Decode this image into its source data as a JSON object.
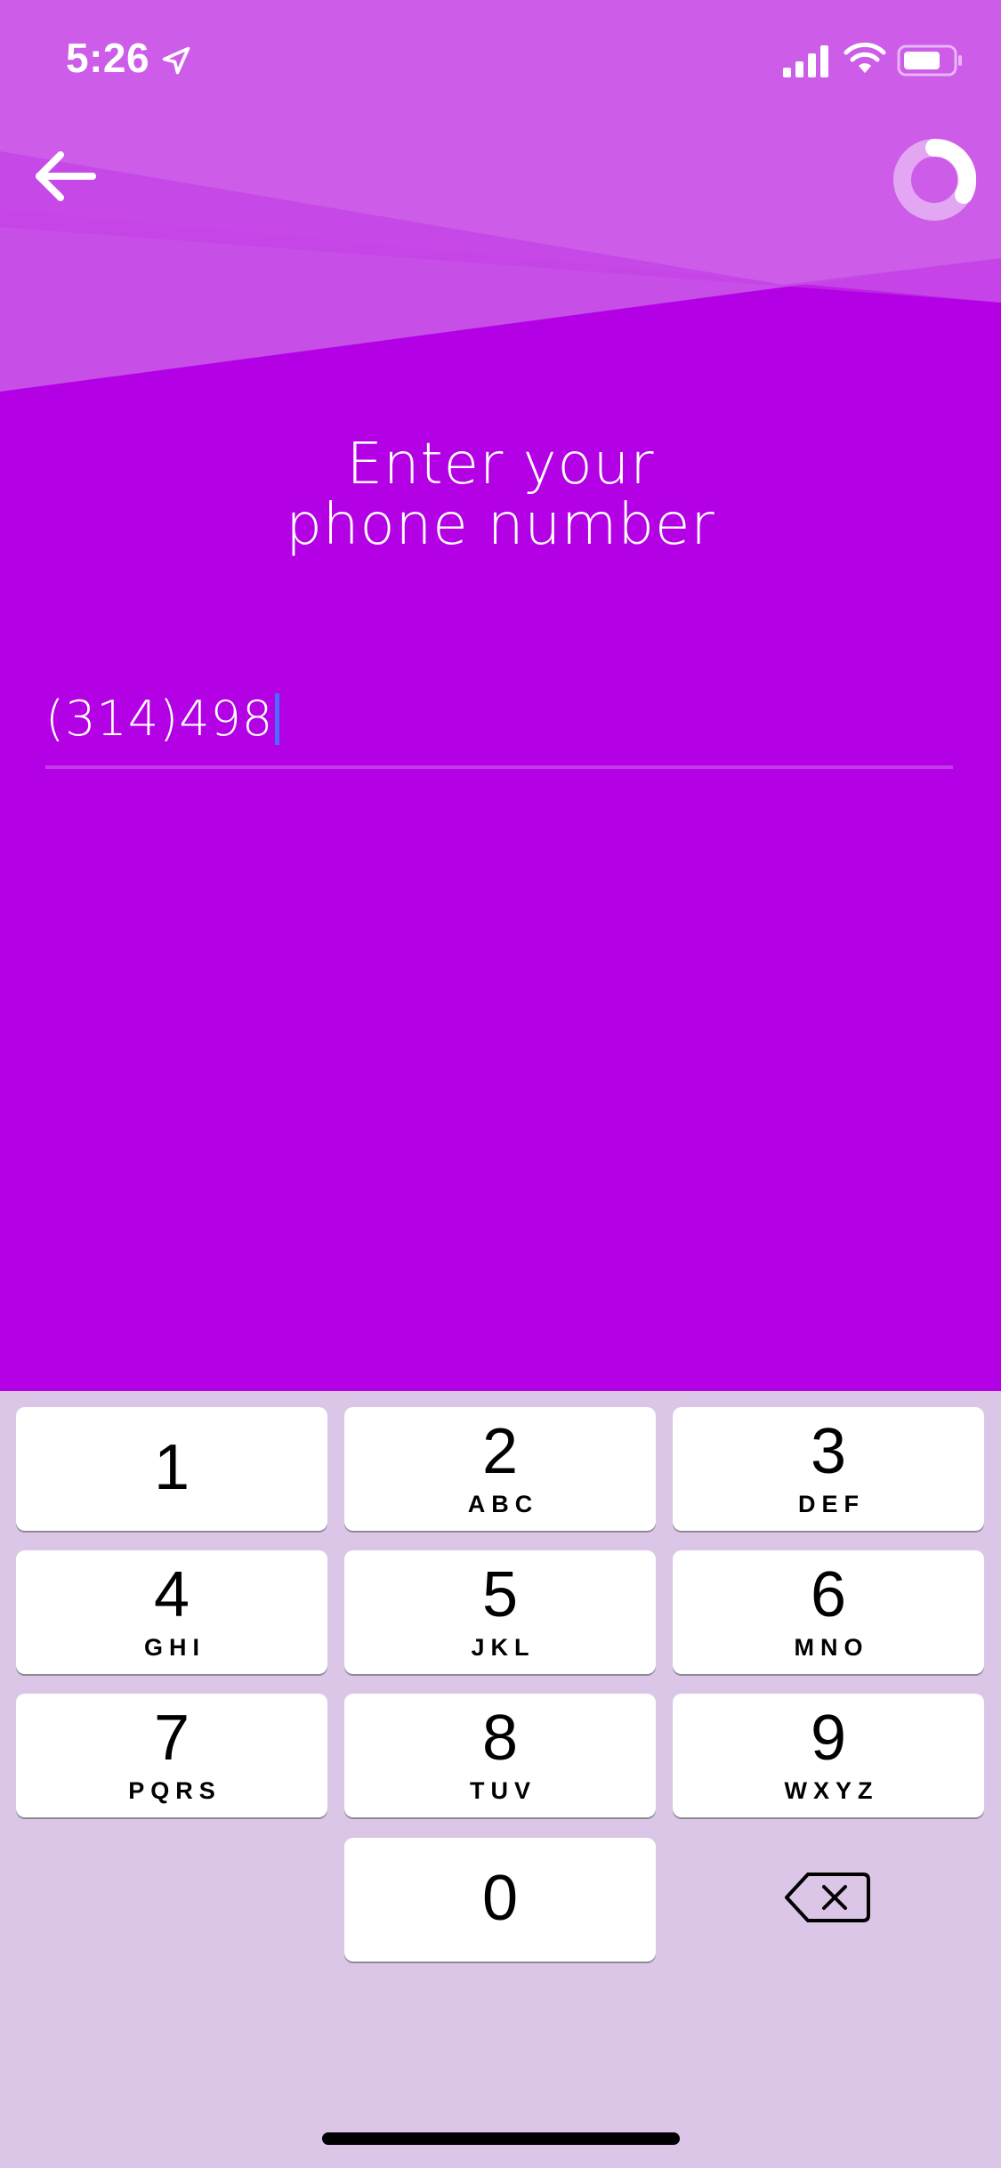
{
  "status_bar": {
    "time": "5:26",
    "icons": [
      "location-arrow-icon",
      "cellular-signal-icon",
      "wifi-icon",
      "battery-icon"
    ]
  },
  "nav": {
    "back_icon": "arrow-left-icon",
    "progress_icon": "progress-ring-icon"
  },
  "title": {
    "line1": "Enter your",
    "line2": "phone number"
  },
  "phone_input": {
    "value": "(314)498"
  },
  "keypad": {
    "keys": [
      {
        "digit": "1",
        "letters": ""
      },
      {
        "digit": "2",
        "letters": "ABC"
      },
      {
        "digit": "3",
        "letters": "DEF"
      },
      {
        "digit": "4",
        "letters": "GHI"
      },
      {
        "digit": "5",
        "letters": "JKL"
      },
      {
        "digit": "6",
        "letters": "MNO"
      },
      {
        "digit": "7",
        "letters": "PQRS"
      },
      {
        "digit": "8",
        "letters": "TUV"
      },
      {
        "digit": "9",
        "letters": "WXYZ"
      },
      {
        "digit": "0",
        "letters": ""
      }
    ],
    "delete_icon": "backspace-icon"
  },
  "colors": {
    "background": "#b300e4",
    "band_light": "#cf5ce8",
    "keyboard": "#dbc6e8",
    "caret": "#4a6cff"
  }
}
